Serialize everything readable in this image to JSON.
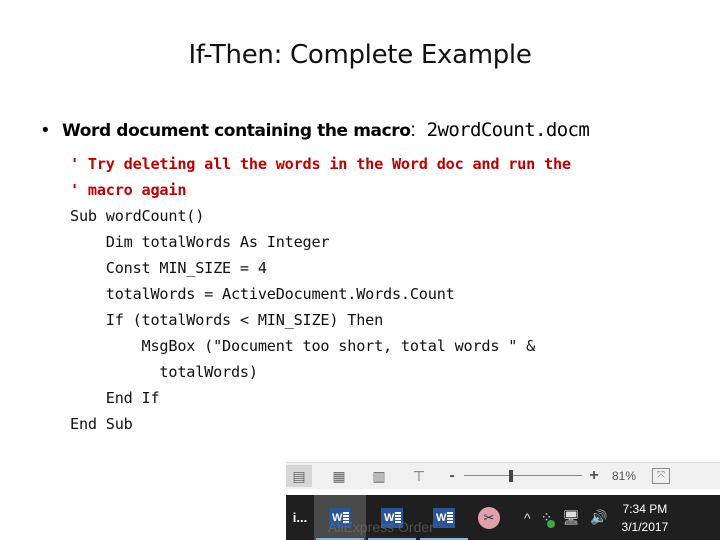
{
  "slide": {
    "title": "If-Then: Complete Example",
    "bullet": {
      "bold_text": "Word document containing the macro",
      "separator": ":",
      "filename": " 2wordCount.docm"
    },
    "code_lines": [
      {
        "text": "' Try deleting all the words in the Word doc and run the",
        "type": "comment"
      },
      {
        "text": "' macro again",
        "type": "comment"
      },
      {
        "text": "Sub wordCount()",
        "type": "code"
      },
      {
        "text": "    Dim totalWords As Integer",
        "type": "code"
      },
      {
        "text": "    Const MIN_SIZE = 4",
        "type": "code"
      },
      {
        "text": "    totalWords = ActiveDocument.Words.Count",
        "type": "code"
      },
      {
        "text": "    If (totalWords < MIN_SIZE) Then",
        "type": "code"
      },
      {
        "text": "        MsgBox (\"Document too short, total words \" &",
        "type": "code"
      },
      {
        "text": "          totalWords)",
        "type": "code"
      },
      {
        "text": "    End If",
        "type": "code"
      },
      {
        "text": "End Sub",
        "type": "code"
      }
    ]
  },
  "statusbar": {
    "view_icons": [
      "read-mode-icon",
      "grid-view-icon",
      "outline-view-icon",
      "presenter-icon"
    ],
    "zoom_minus": "-",
    "zoom_plus": "+",
    "zoom_level_percent": 81,
    "zoom_label": "81%",
    "fit_icon": "fit-to-window-icon"
  },
  "taskbar": {
    "overflow_label": "i...",
    "apps": [
      {
        "name": "word-app-1",
        "icon_letter": "W",
        "active": true
      },
      {
        "name": "word-app-2",
        "icon_letter": "W",
        "active": false
      },
      {
        "name": "word-app-3",
        "icon_letter": "W",
        "active": false
      }
    ],
    "snipping_tool_icon": "✂",
    "tray_icons": {
      "chevron": "^",
      "network": "🖥",
      "volume": "🔊"
    },
    "time": "7:34 PM",
    "date": "3/1/2017",
    "watermark": "AliExpress Order"
  },
  "colors": {
    "comment": "#c00000",
    "word_blue": "#2b579a",
    "taskbar": "#1f1f1f"
  }
}
